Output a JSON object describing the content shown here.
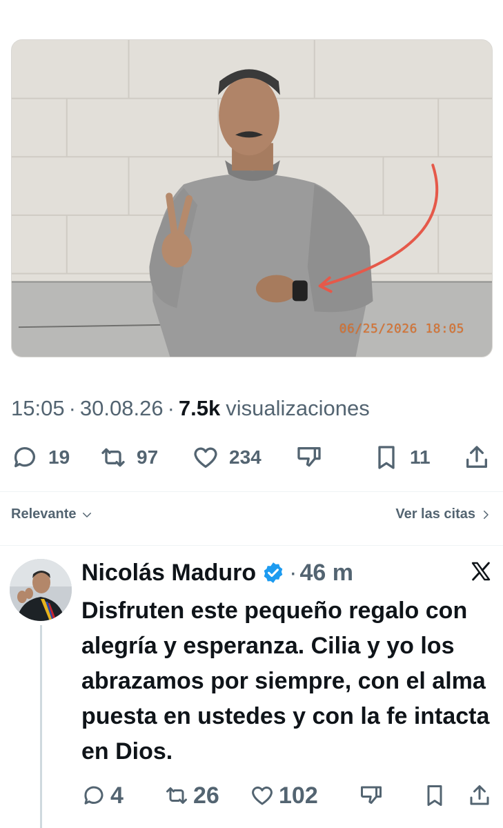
{
  "photo": {
    "alt_icon": "photo-image",
    "timestamp_overlay": "06/25/2026  18:05"
  },
  "tweet_meta": {
    "time": "15:05",
    "date": "30.08.26",
    "views_count": "7.5k",
    "views_label": "visualizaciones"
  },
  "main_actions": {
    "replies": "19",
    "retweets": "97",
    "likes": "234",
    "bookmarks": "11"
  },
  "sort": {
    "relevance_label": "Relevante",
    "quotes_label": "Ver las citas"
  },
  "reply": {
    "author_name": "Nicolás Maduro",
    "time_ago": "46 m",
    "text": "Disfruten este pequeño regalo con alegría y esperanza. Cilia y yo los abrazamos por siempre, con el alma puesta en ustedes y con la fe intacta en Dios.",
    "replies": "4",
    "retweets": "26",
    "likes": "102"
  },
  "colors": {
    "text_primary": "#0f1419",
    "text_secondary": "#536471",
    "verified_blue": "#1d9bf0",
    "arrow_red": "#e5594a"
  }
}
